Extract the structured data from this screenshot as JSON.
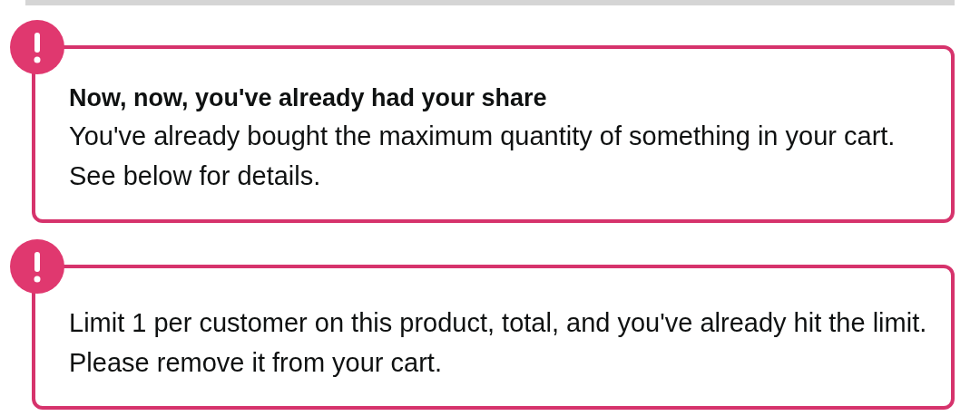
{
  "alerts": [
    {
      "title": "Now, now, you've already had your share",
      "message": "You've already bought the maximum quantity of something in your cart. See below for details."
    },
    {
      "message": "Limit 1 per customer on this product, total, and you've already hit the limit. Please remove it from your cart."
    }
  ]
}
